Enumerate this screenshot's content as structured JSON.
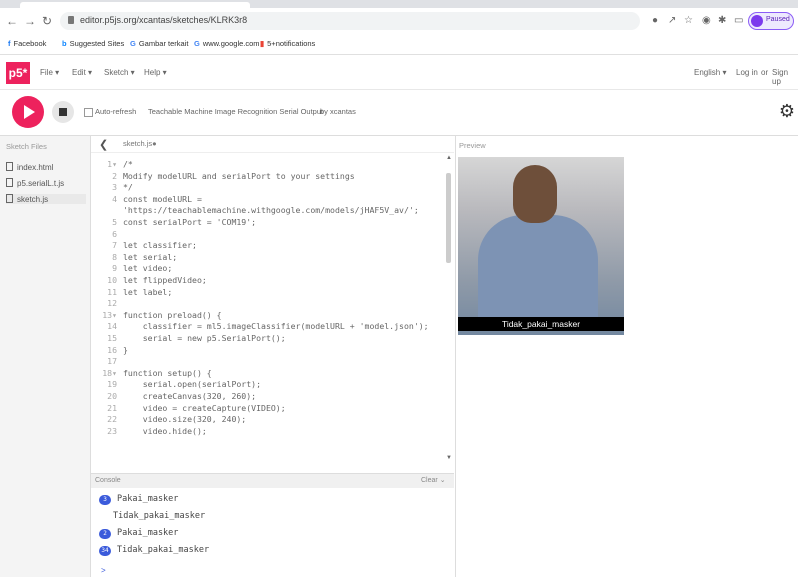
{
  "browser": {
    "url": "editor.p5js.org/xcantas/sketches/KLRK3r8",
    "profile_label": "Paused"
  },
  "bookmarks": [
    {
      "icon": "facebook-icon",
      "label": "Facebook"
    },
    {
      "icon": "bing-icon",
      "label": "Suggested Sites"
    },
    {
      "icon": "google-icon",
      "label": "Gambar terkait"
    },
    {
      "icon": "google-icon",
      "label": "www.google.com"
    },
    {
      "icon": "notification-icon",
      "label": "5+notifications"
    }
  ],
  "p5": {
    "logo": "p5*",
    "menus": [
      "File ▾",
      "Edit ▾",
      "Sketch ▾",
      "Help ▾"
    ],
    "language": "English ▾",
    "login": "Log in",
    "or": "or",
    "signup": "Sign up"
  },
  "toolbar": {
    "auto_refresh": "Auto-refresh",
    "sketch_name": "Teachable Machine Image Recognition Serial Output",
    "by": "by xcantas"
  },
  "sidebar": {
    "title": "Sketch Files",
    "files": [
      "index.html",
      "p5.serialL.t.js",
      "sketch.js"
    ]
  },
  "editor": {
    "tab": "sketch.js●",
    "lines": [
      {
        "n": "1▾",
        "code": "/*"
      },
      {
        "n": "2",
        "code": "Modify modelURL and serialPort to your settings"
      },
      {
        "n": "3",
        "code": "*/"
      },
      {
        "n": "4",
        "code": "const modelURL ="
      },
      {
        "n": "",
        "code": "'https://teachablemachine.withgoogle.com/models/jHAF5V_av/';"
      },
      {
        "n": "5",
        "code": "const serialPort = 'COM19';"
      },
      {
        "n": "6",
        "code": ""
      },
      {
        "n": "7",
        "code": "let classifier;"
      },
      {
        "n": "8",
        "code": "let serial;"
      },
      {
        "n": "9",
        "code": "let video;"
      },
      {
        "n": "10",
        "code": "let flippedVideo;"
      },
      {
        "n": "11",
        "code": "let label;"
      },
      {
        "n": "12",
        "code": ""
      },
      {
        "n": "13▾",
        "code": "function preload() {"
      },
      {
        "n": "14",
        "code": "    classifier = ml5.imageClassifier(modelURL + 'model.json');"
      },
      {
        "n": "15",
        "code": "    serial = new p5.SerialPort();"
      },
      {
        "n": "16",
        "code": "}"
      },
      {
        "n": "17",
        "code": ""
      },
      {
        "n": "18▾",
        "code": "function setup() {"
      },
      {
        "n": "19",
        "code": "    serial.open(serialPort);"
      },
      {
        "n": "20",
        "code": "    createCanvas(320, 260);"
      },
      {
        "n": "21",
        "code": "    video = createCapture(VIDEO);"
      },
      {
        "n": "22",
        "code": "    video.size(320, 240);"
      },
      {
        "n": "23",
        "code": "    video.hide();"
      }
    ]
  },
  "console": {
    "title": "Console",
    "clear": "Clear",
    "entries": [
      {
        "badge": "3",
        "text": "Pakai_masker"
      },
      {
        "badge": "",
        "text": "Tidak_pakai_masker"
      },
      {
        "badge": "2",
        "text": "Pakai_masker"
      },
      {
        "badge": "34",
        "text": "Tidak_pakai_masker"
      }
    ],
    "prompt": ">"
  },
  "preview": {
    "title": "Preview",
    "prediction_label": "Tidak_pakai_masker"
  }
}
